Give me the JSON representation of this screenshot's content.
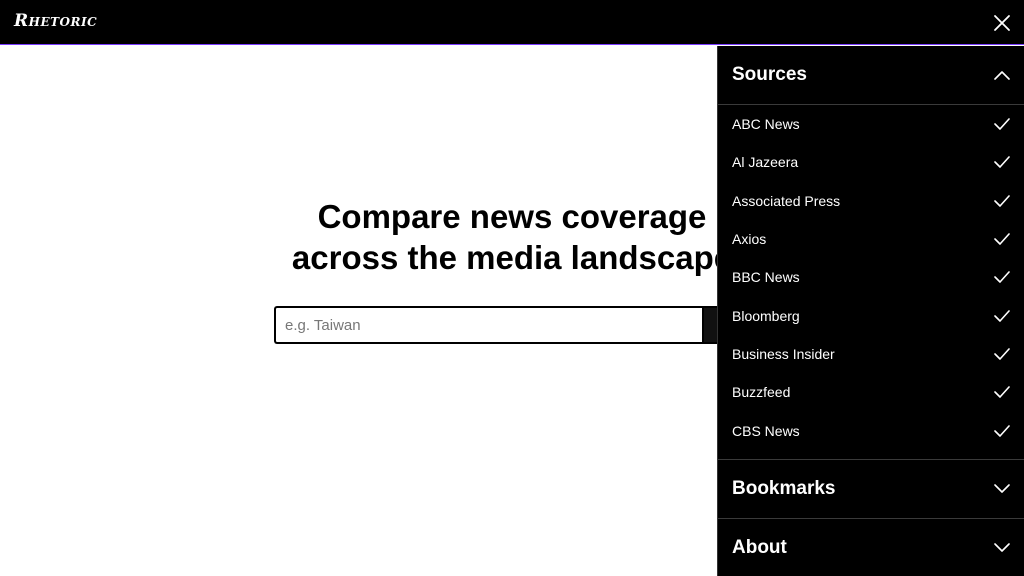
{
  "header": {
    "logo": "Rhetoric",
    "close_icon": "close-icon"
  },
  "main": {
    "headline_line1": "Compare news coverage",
    "headline_line2": "across the media landscape",
    "search": {
      "placeholder": "e.g. Taiwan",
      "value": ""
    }
  },
  "panel": {
    "sources": {
      "title": "Sources",
      "toggle_icon": "chevron-up-icon",
      "items": [
        {
          "label": "ABC News",
          "checked": true
        },
        {
          "label": "Al Jazeera",
          "checked": true
        },
        {
          "label": "Associated Press",
          "checked": true
        },
        {
          "label": "Axios",
          "checked": true
        },
        {
          "label": "BBC News",
          "checked": true
        },
        {
          "label": "Bloomberg",
          "checked": true
        },
        {
          "label": "Business Insider",
          "checked": true
        },
        {
          "label": "Buzzfeed",
          "checked": true
        },
        {
          "label": "CBS News",
          "checked": true
        }
      ]
    },
    "bookmarks": {
      "title": "Bookmarks",
      "toggle_icon": "chevron-down-icon"
    },
    "about": {
      "title": "About",
      "toggle_icon": "chevron-down-icon"
    }
  },
  "colors": {
    "bar": "#000000",
    "accent_line": "#7a3cff",
    "panel_bg": "#000000",
    "divider": "#3a3a3a"
  }
}
